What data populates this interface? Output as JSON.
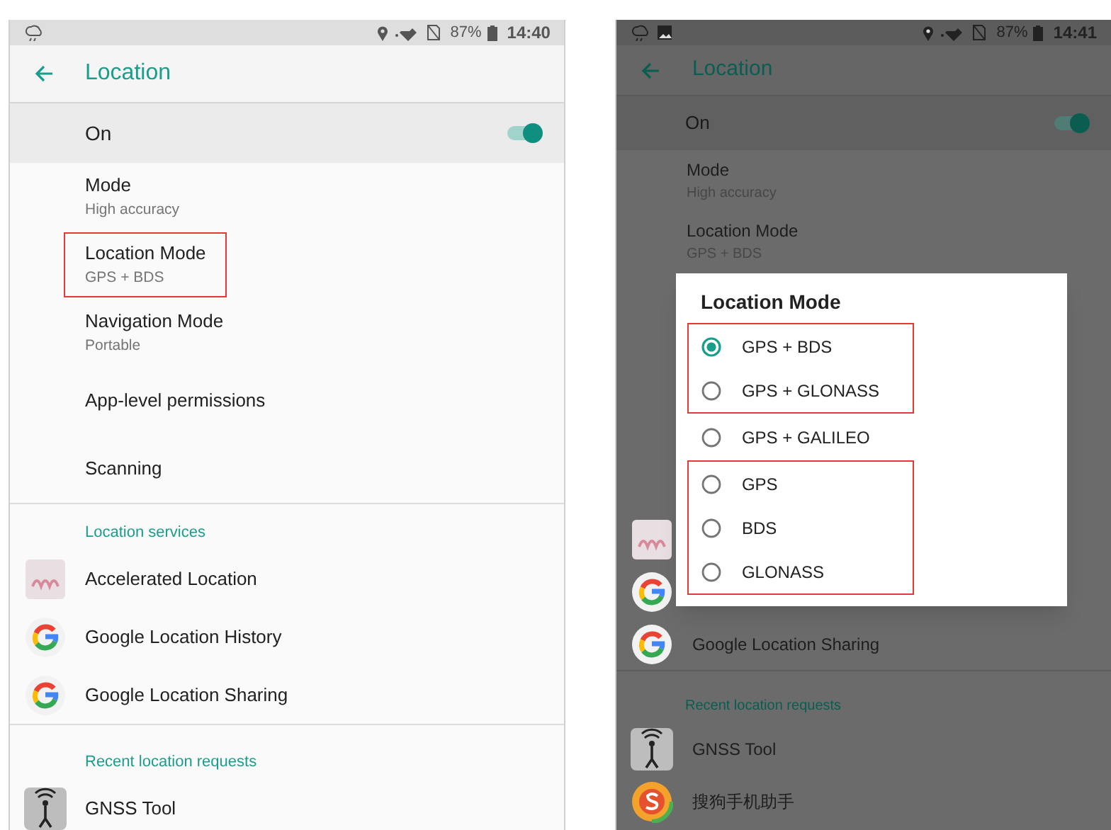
{
  "screens": [
    {
      "dimmed": false,
      "status_bar": {
        "notification_icons": [
          {
            "kind": "cloud"
          }
        ],
        "battery": "87%",
        "time": "14:40"
      },
      "title": "Location",
      "master_switch": {
        "label": "On",
        "on": true
      },
      "settings": [
        {
          "title": "Mode",
          "summary": "High accuracy",
          "highlighted": false
        },
        {
          "title": "Location Mode",
          "summary": "GPS + BDS",
          "highlighted": true
        },
        {
          "title": "Navigation Mode",
          "summary": "Portable",
          "highlighted": false
        },
        {
          "title": "App-level permissions",
          "highlighted": false
        },
        {
          "title": "Scanning",
          "highlighted": false
        }
      ],
      "sections": [
        {
          "title": "Location services",
          "apps": [
            {
              "kind": "tile",
              "label": "Accelerated Location"
            },
            {
              "kind": "google",
              "label": "Google Location History"
            },
            {
              "kind": "google",
              "label": "Google Location Sharing"
            }
          ]
        },
        {
          "title": "Recent location requests",
          "apps": [
            {
              "kind": "antenna",
              "label": "GNSS Tool"
            }
          ]
        }
      ]
    },
    {
      "dimmed": true,
      "status_bar": {
        "notification_icons": [
          {
            "kind": "cloud"
          },
          {
            "kind": "picture"
          }
        ],
        "battery": "87%",
        "time": "14:41"
      },
      "title": "Location",
      "master_switch": {
        "label": "On",
        "on": true
      },
      "settings": [
        {
          "title": "Mode",
          "summary": "High accuracy",
          "highlighted": false
        },
        {
          "title": "Location Mode",
          "summary": "GPS + BDS",
          "highlighted": false
        }
      ],
      "sections": [
        {
          "apps": [
            {
              "kind": "tile"
            },
            {
              "kind": "google"
            },
            {
              "kind": "google",
              "label": "Google Location Sharing"
            }
          ]
        },
        {
          "title": "Recent location requests",
          "apps": [
            {
              "kind": "antenna",
              "label": "GNSS Tool"
            },
            {
              "kind": "sogou",
              "label": "搜狗手机助手"
            }
          ]
        }
      ],
      "dialog": {
        "title": "Location Mode",
        "option_groups": [
          {
            "highlighted": true,
            "options": [
              {
                "label": "GPS + BDS",
                "selected": true
              },
              {
                "label": "GPS + GLONASS",
                "selected": false
              }
            ]
          },
          {
            "highlighted": false,
            "options": [
              {
                "label": "GPS + GALILEO",
                "selected": false
              }
            ]
          },
          {
            "highlighted": true,
            "options": [
              {
                "label": "GPS",
                "selected": false
              },
              {
                "label": "BDS",
                "selected": false
              },
              {
                "label": "GLONASS",
                "selected": false
              }
            ]
          }
        ]
      }
    }
  ]
}
